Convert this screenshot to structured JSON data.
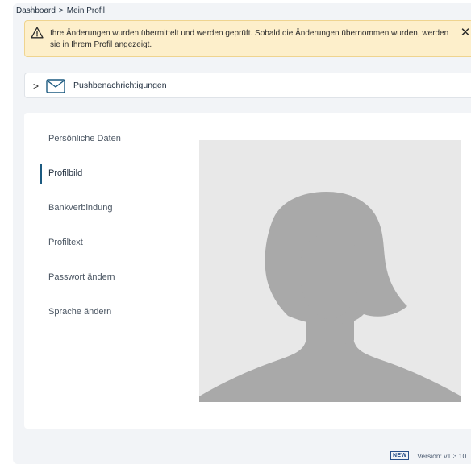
{
  "breadcrumb": {
    "items": [
      "Dashboard",
      "Mein Profil"
    ],
    "separator": ">"
  },
  "alert": {
    "icon": "warning-icon",
    "text": "Ihre Änderungen wurden übermittelt und werden geprüft. Sobald die Änderungen übernommen wurden, werden sie in Ihrem Profil angezeigt.",
    "close_label": "✕",
    "colors": {
      "background": "#fdefcb",
      "border": "#efd48f"
    }
  },
  "accordion": {
    "chevron": ">",
    "icon": "mail-icon",
    "label": "Pushbenachrichtigungen"
  },
  "profile_nav": {
    "items": [
      {
        "label": "Persönliche Daten",
        "active": false
      },
      {
        "label": "Profilbild",
        "active": true
      },
      {
        "label": "Bankverbindung",
        "active": false
      },
      {
        "label": "Profiltext",
        "active": false
      },
      {
        "label": "Passwort ändern",
        "active": false
      },
      {
        "label": "Sprache ändern",
        "active": false
      }
    ],
    "accent_color": "#1c5a80"
  },
  "profile_picture": {
    "placeholder": "default-avatar-silhouette",
    "edit_icon": "edit-icon"
  },
  "footer": {
    "badge": "NEW",
    "version": "Version: v1.3.10"
  }
}
